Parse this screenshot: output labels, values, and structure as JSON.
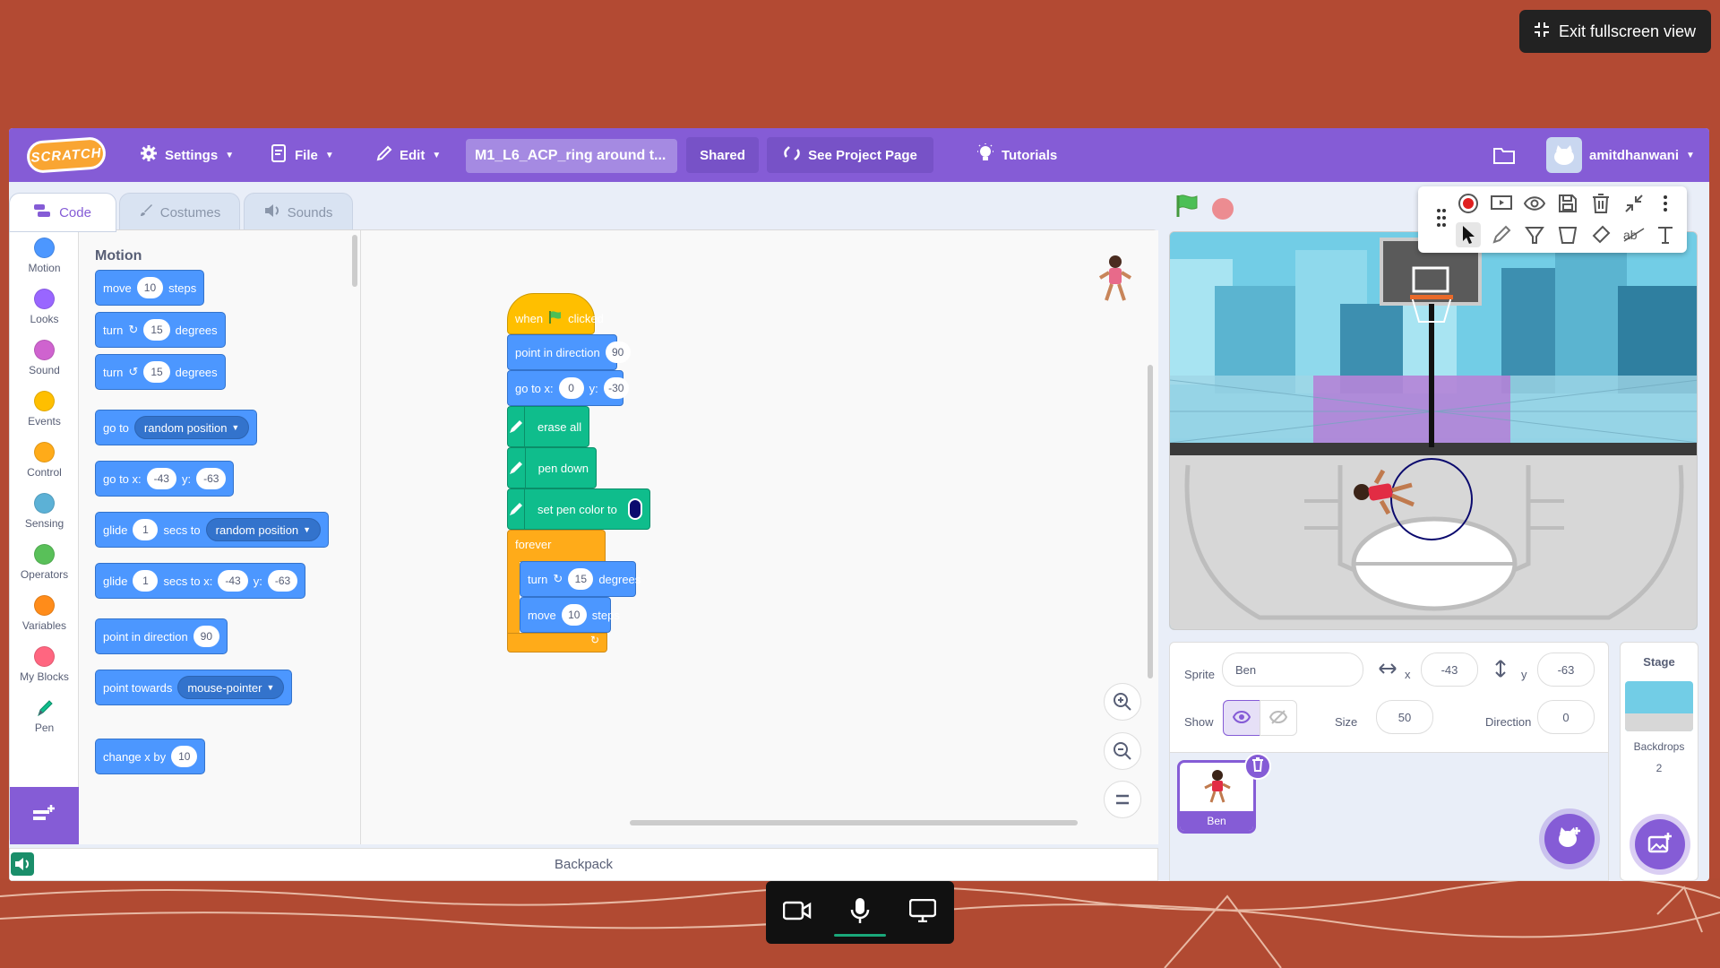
{
  "overlay": {
    "exit_fullscreen_label": "Exit fullscreen view"
  },
  "menubar": {
    "logo_text": "SCRATCH",
    "settings_label": "Settings",
    "file_label": "File",
    "edit_label": "Edit",
    "project_title": "M1_L6_ACP_ring around t...",
    "shared_label": "Shared",
    "see_project_page_label": "See Project Page",
    "tutorials_label": "Tutorials",
    "username": "amitdhanwani"
  },
  "tabs": {
    "code": "Code",
    "costumes": "Costumes",
    "sounds": "Sounds"
  },
  "categories": [
    {
      "label": "Motion",
      "color": "#4c97ff"
    },
    {
      "label": "Looks",
      "color": "#9966ff"
    },
    {
      "label": "Sound",
      "color": "#cf63cf"
    },
    {
      "label": "Events",
      "color": "#ffbf00"
    },
    {
      "label": "Control",
      "color": "#ffab19"
    },
    {
      "label": "Sensing",
      "color": "#5cb1d6"
    },
    {
      "label": "Operators",
      "color": "#59c059"
    },
    {
      "label": "Variables",
      "color": "#ff8c1a"
    },
    {
      "label": "My Blocks",
      "color": "#ff6680"
    },
    {
      "label": "Pen",
      "color": "#0fbd8c"
    }
  ],
  "palette": {
    "title": "Motion",
    "move": {
      "a": "move",
      "v": "10",
      "b": "steps"
    },
    "turn_right": {
      "a": "turn",
      "v": "15",
      "b": "degrees"
    },
    "turn_left": {
      "a": "turn",
      "v": "15",
      "b": "degrees"
    },
    "goto_random": {
      "a": "go to",
      "d": "random position"
    },
    "goto_xy": {
      "a": "go to x:",
      "x": "-43",
      "yl": "y:",
      "y": "-63"
    },
    "glide_random": {
      "a": "glide",
      "v": "1",
      "b": "secs to",
      "d": "random position"
    },
    "glide_xy": {
      "a": "glide",
      "v": "1",
      "b": "secs to x:",
      "x": "-43",
      "yl": "y:",
      "y": "-63"
    },
    "point_dir": {
      "a": "point in direction",
      "v": "90"
    },
    "point_towards": {
      "a": "point towards",
      "d": "mouse-pointer"
    },
    "change_x": {
      "a": "change x by",
      "v": "10"
    }
  },
  "script": {
    "when": "when",
    "clicked": "clicked",
    "point_dir": {
      "a": "point in direction",
      "v": "90"
    },
    "goto": {
      "a": "go to x:",
      "x": "0",
      "yl": "y:",
      "y": "-30"
    },
    "erase_all": "erase all",
    "pen_down": "pen down",
    "set_pen_color": "set pen color to",
    "pen_color": "#0b0a6e",
    "forever": "forever",
    "turn": {
      "a": "turn",
      "v": "15",
      "b": "degrees"
    },
    "move": {
      "a": "move",
      "v": "10",
      "b": "steps"
    }
  },
  "backpack_label": "Backpack",
  "sprite_info": {
    "sprite_label": "Sprite",
    "sprite_name": "Ben",
    "x_label": "x",
    "x": "-43",
    "y_label": "y",
    "y": "-63",
    "show_label": "Show",
    "size_label": "Size",
    "size": "50",
    "direction_label": "Direction",
    "direction": "0"
  },
  "sprites": [
    {
      "name": "Ben"
    }
  ],
  "stage_pane": {
    "title": "Stage",
    "backdrops_label": "Backdrops",
    "backdrops_count": "2"
  }
}
